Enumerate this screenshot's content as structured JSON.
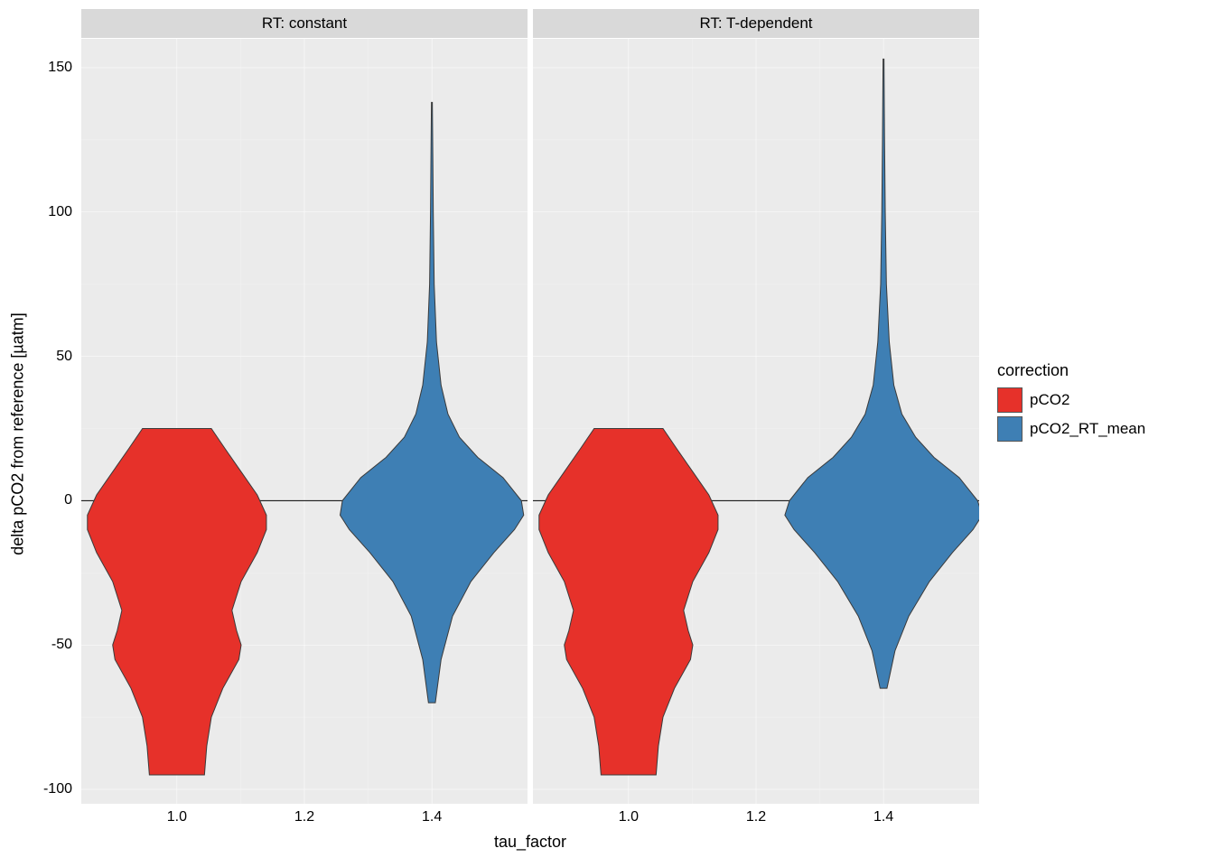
{
  "chart_data": {
    "type": "violin",
    "title": "",
    "xlabel": "tau_factor",
    "ylabel": "delta pCO2 from reference [µatm]",
    "x_ticks": [
      1.0,
      1.2,
      1.4
    ],
    "y_ticks": [
      -100,
      -50,
      0,
      50,
      100,
      150
    ],
    "ylim": [
      -105,
      160
    ],
    "xlim": [
      0.85,
      1.55
    ],
    "hline": 0,
    "facets": [
      "RT: constant",
      "RT: T-dependent"
    ],
    "legend_title": "correction",
    "legend_items": [
      {
        "name": "pCO2",
        "color": "#E6312A"
      },
      {
        "name": "pCO2_RT_mean",
        "color": "#3E7FB4"
      }
    ],
    "violins": {
      "RT: constant": [
        {
          "series": "pCO2",
          "x": 1.0,
          "extent": [
            -95,
            25
          ],
          "profile": [
            {
              "y": -95,
              "w": 0.24
            },
            {
              "y": -85,
              "w": 0.26
            },
            {
              "y": -75,
              "w": 0.3
            },
            {
              "y": -65,
              "w": 0.4
            },
            {
              "y": -55,
              "w": 0.54
            },
            {
              "y": -50,
              "w": 0.56
            },
            {
              "y": -45,
              "w": 0.52
            },
            {
              "y": -38,
              "w": 0.48
            },
            {
              "y": -28,
              "w": 0.56
            },
            {
              "y": -18,
              "w": 0.7
            },
            {
              "y": -10,
              "w": 0.78
            },
            {
              "y": -5,
              "w": 0.78
            },
            {
              "y": 2,
              "w": 0.7
            },
            {
              "y": 10,
              "w": 0.56
            },
            {
              "y": 18,
              "w": 0.42
            },
            {
              "y": 25,
              "w": 0.3
            }
          ]
        },
        {
          "series": "pCO2_RT_mean",
          "x": 1.4,
          "extent": [
            -70,
            138
          ],
          "profile": [
            {
              "y": -70,
              "w": 0.03
            },
            {
              "y": -55,
              "w": 0.08
            },
            {
              "y": -40,
              "w": 0.18
            },
            {
              "y": -28,
              "w": 0.34
            },
            {
              "y": -18,
              "w": 0.54
            },
            {
              "y": -10,
              "w": 0.72
            },
            {
              "y": -5,
              "w": 0.8
            },
            {
              "y": 0,
              "w": 0.78
            },
            {
              "y": 8,
              "w": 0.62
            },
            {
              "y": 15,
              "w": 0.4
            },
            {
              "y": 22,
              "w": 0.24
            },
            {
              "y": 30,
              "w": 0.14
            },
            {
              "y": 40,
              "w": 0.08
            },
            {
              "y": 55,
              "w": 0.04
            },
            {
              "y": 75,
              "w": 0.02
            },
            {
              "y": 100,
              "w": 0.012
            },
            {
              "y": 120,
              "w": 0.008
            },
            {
              "y": 138,
              "w": 0.004
            }
          ]
        }
      ],
      "RT: T-dependent": [
        {
          "series": "pCO2",
          "x": 1.0,
          "extent": [
            -95,
            25
          ],
          "profile": [
            {
              "y": -95,
              "w": 0.24
            },
            {
              "y": -85,
              "w": 0.26
            },
            {
              "y": -75,
              "w": 0.3
            },
            {
              "y": -65,
              "w": 0.4
            },
            {
              "y": -55,
              "w": 0.54
            },
            {
              "y": -50,
              "w": 0.56
            },
            {
              "y": -45,
              "w": 0.52
            },
            {
              "y": -38,
              "w": 0.48
            },
            {
              "y": -28,
              "w": 0.56
            },
            {
              "y": -18,
              "w": 0.7
            },
            {
              "y": -10,
              "w": 0.78
            },
            {
              "y": -5,
              "w": 0.78
            },
            {
              "y": 2,
              "w": 0.7
            },
            {
              "y": 10,
              "w": 0.56
            },
            {
              "y": 18,
              "w": 0.42
            },
            {
              "y": 25,
              "w": 0.3
            }
          ]
        },
        {
          "series": "pCO2_RT_mean",
          "x": 1.4,
          "extent": [
            -65,
            153
          ],
          "profile": [
            {
              "y": -65,
              "w": 0.03
            },
            {
              "y": -52,
              "w": 0.1
            },
            {
              "y": -40,
              "w": 0.22
            },
            {
              "y": -28,
              "w": 0.4
            },
            {
              "y": -18,
              "w": 0.6
            },
            {
              "y": -10,
              "w": 0.78
            },
            {
              "y": -5,
              "w": 0.86
            },
            {
              "y": 0,
              "w": 0.82
            },
            {
              "y": 8,
              "w": 0.66
            },
            {
              "y": 15,
              "w": 0.44
            },
            {
              "y": 22,
              "w": 0.28
            },
            {
              "y": 30,
              "w": 0.16
            },
            {
              "y": 40,
              "w": 0.09
            },
            {
              "y": 55,
              "w": 0.05
            },
            {
              "y": 75,
              "w": 0.025
            },
            {
              "y": 100,
              "w": 0.015
            },
            {
              "y": 125,
              "w": 0.009
            },
            {
              "y": 153,
              "w": 0.004
            }
          ]
        }
      ]
    }
  },
  "y_tick_labels": [
    "-100",
    "-50",
    "0",
    "50",
    "100",
    "150"
  ],
  "x_tick_labels": [
    "1.0",
    "1.2",
    "1.4"
  ]
}
